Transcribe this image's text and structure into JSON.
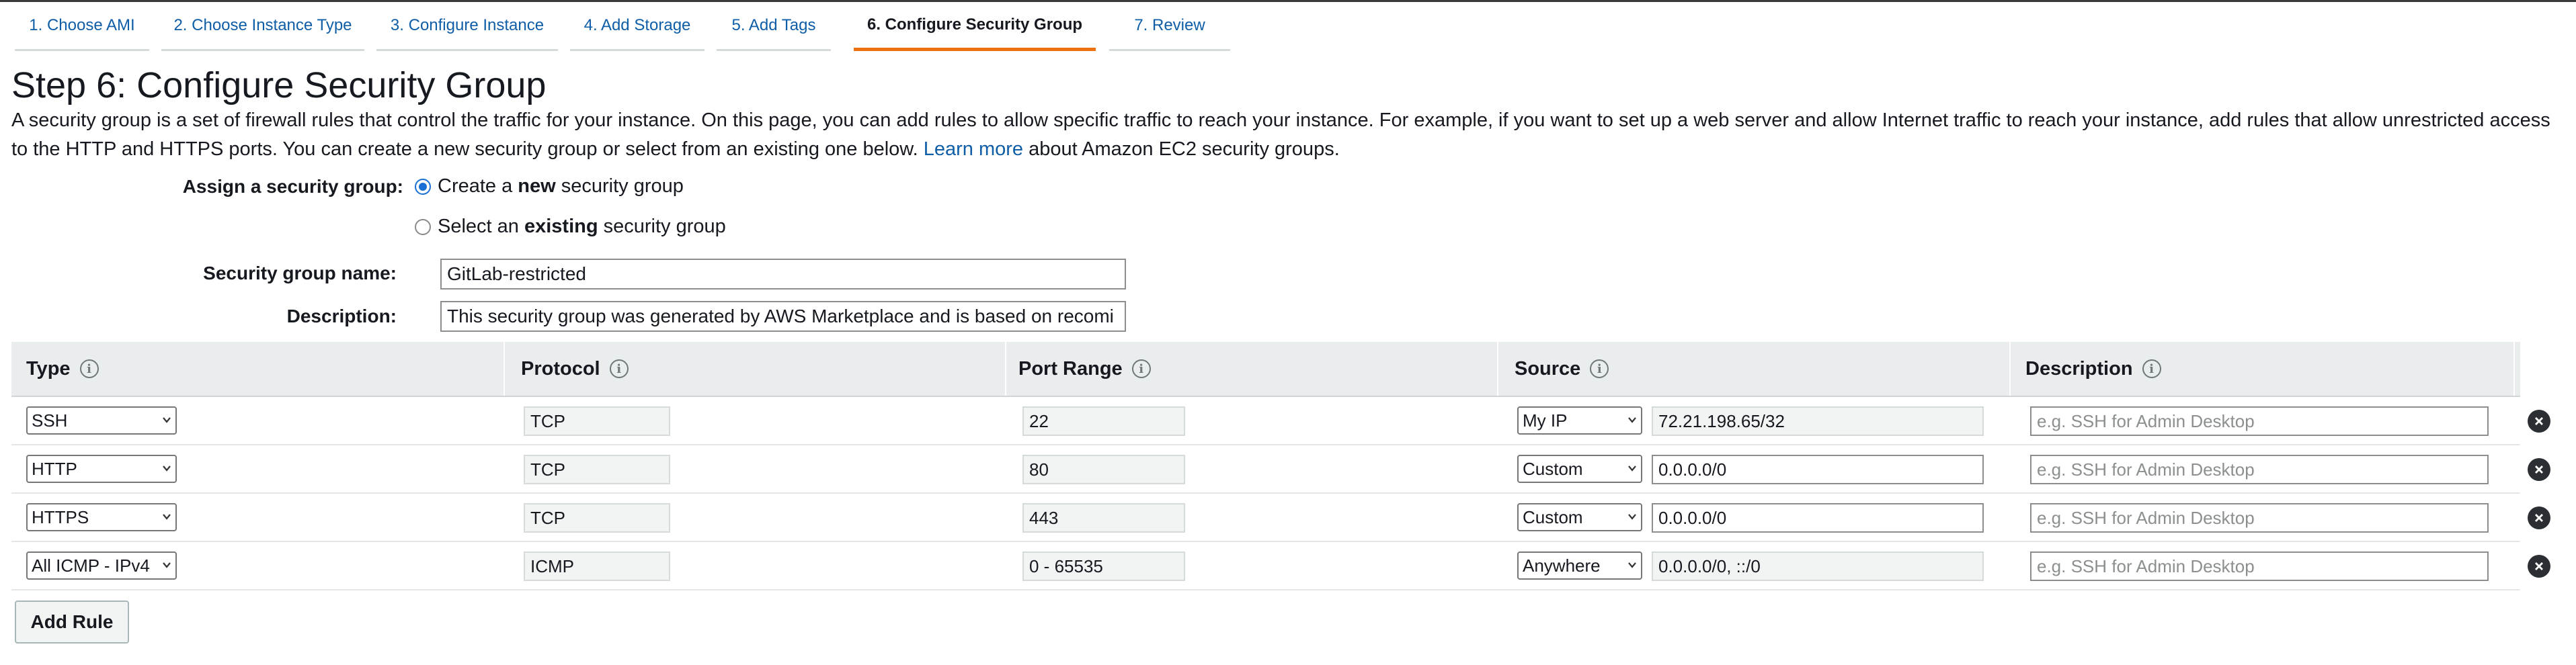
{
  "tabs": [
    {
      "label": "1. Choose AMI"
    },
    {
      "label": "2. Choose Instance Type"
    },
    {
      "label": "3. Configure Instance"
    },
    {
      "label": "4. Add Storage"
    },
    {
      "label": "5. Add Tags"
    },
    {
      "label": "6. Configure Security Group",
      "active": true
    },
    {
      "label": "7. Review"
    }
  ],
  "page_title": "Step 6: Configure Security Group",
  "intro": {
    "text": "A security group is a set of firewall rules that control the traffic for your instance. On this page, you can add rules to allow specific traffic to reach your instance. For example, if you want to set up a web server and allow Internet traffic to reach your instance, add rules that allow unrestricted access to the HTTP and HTTPS ports. You can create a new security group or select from an existing one below.",
    "link": "Learn more",
    "suffix": "about Amazon EC2 security groups."
  },
  "assign": {
    "label": "Assign a security group:",
    "option_new": {
      "pre": "Create a",
      "bold": "new",
      "post": "security group",
      "checked": true
    },
    "option_existing": {
      "pre": "Select an",
      "bold": "existing",
      "post": "security group",
      "checked": false
    }
  },
  "form": {
    "name_label": "Security group name:",
    "name_value": "GitLab-restricted",
    "desc_label": "Description:",
    "desc_value": "This security group was generated by AWS Marketplace and is based on recomi"
  },
  "table": {
    "headers": [
      "Type",
      "Protocol",
      "Port Range",
      "Source",
      "Description"
    ],
    "rows": [
      {
        "type": "SSH",
        "protocol": "TCP",
        "port": "22",
        "source_mode": "My IP",
        "source_value": "72.21.198.65/32",
        "description_placeholder": "e.g. SSH for Admin Desktop"
      },
      {
        "type": "HTTP",
        "protocol": "TCP",
        "port": "80",
        "source_mode": "Custom",
        "source_value": "0.0.0.0/0",
        "description_placeholder": "e.g. SSH for Admin Desktop"
      },
      {
        "type": "HTTPS",
        "protocol": "TCP",
        "port": "443",
        "source_mode": "Custom",
        "source_value": "0.0.0.0/0",
        "description_placeholder": "e.g. SSH for Admin Desktop"
      },
      {
        "type": "All ICMP - IPv4",
        "protocol": "ICMP",
        "port": "0 - 65535",
        "source_mode": "Anywhere",
        "source_value": "0.0.0.0/0, ::/0",
        "description_placeholder": "e.g. SSH for Admin Desktop"
      }
    ]
  },
  "add_rule_label": "Add Rule",
  "colors": {
    "accent": "#ec7211",
    "link": "#0f5ea8",
    "header_bg": "#eaeded"
  }
}
